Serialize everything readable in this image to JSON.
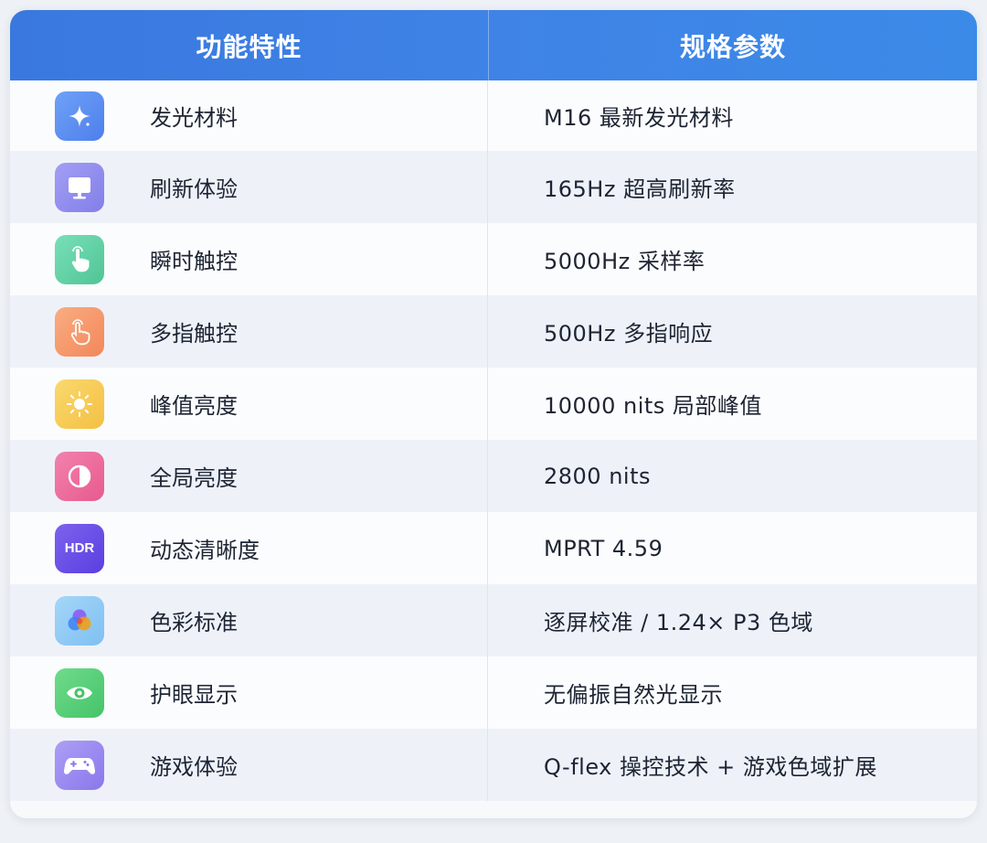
{
  "header": {
    "feature_col": "功能特性",
    "spec_col": "规格参数"
  },
  "colors": {
    "header_blue": "#3f83e6",
    "row_alt": "#eef2f8",
    "text": "#1d2433"
  },
  "rows": [
    {
      "icon": "sparkle-icon",
      "icon_color": "#5c8ff2",
      "feature": "发光材料",
      "spec": "M16 最新发光材料"
    },
    {
      "icon": "monitor-icon",
      "icon_color": "#8f8cf0",
      "feature": "刷新体验",
      "spec": "165Hz 超高刷新率"
    },
    {
      "icon": "tap-hand-icon",
      "icon_color": "#5fd3a8",
      "feature": "瞬时触控",
      "spec": "5000Hz 采样率"
    },
    {
      "icon": "multi-touch-hand-icon",
      "icon_color": "#f79a6a",
      "feature": "多指触控",
      "spec": "500Hz 多指响应"
    },
    {
      "icon": "sun-icon",
      "icon_color": "#f7cd5a",
      "feature": "峰值亮度",
      "spec": "10000 nits 局部峰值"
    },
    {
      "icon": "contrast-icon",
      "icon_color": "#ee6fa0",
      "feature": "全局亮度",
      "spec": "2800 nits"
    },
    {
      "icon": "hdr-icon",
      "icon_color": "#6b4fe6",
      "icon_text": "HDR",
      "feature": "动态清晰度",
      "spec": "MPRT 4.59"
    },
    {
      "icon": "color-circles-icon",
      "icon_color": "#8ec9f5",
      "feature": "色彩标准",
      "spec": "逐屏校准 / 1.24× P3 色域"
    },
    {
      "icon": "eye-icon",
      "icon_color": "#59cf78",
      "feature": "护眼显示",
      "spec": "无偏振自然光显示"
    },
    {
      "icon": "gamepad-icon",
      "icon_color": "#9d8df2",
      "feature": "游戏体验",
      "spec": "Q-flex 操控技术 + 游戏色域扩展"
    }
  ]
}
